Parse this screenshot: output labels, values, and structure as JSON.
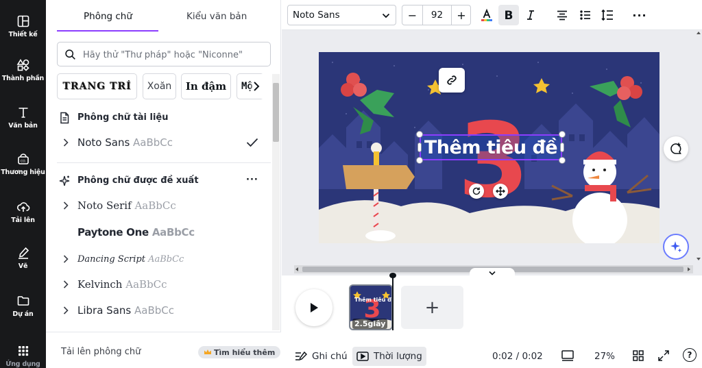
{
  "sidebar": {
    "items": [
      {
        "label": "Thiết kế",
        "icon": "layout-icon"
      },
      {
        "label": "Thành phần",
        "icon": "shapes-icon"
      },
      {
        "label": "Văn bản",
        "icon": "text-icon"
      },
      {
        "label": "Thương hiệu",
        "icon": "brand-icon"
      },
      {
        "label": "Tải lên",
        "icon": "upload-icon"
      },
      {
        "label": "Vẽ",
        "icon": "draw-icon"
      },
      {
        "label": "Dự án",
        "icon": "folder-icon"
      },
      {
        "label": "Ứng dụng",
        "icon": "apps-icon"
      }
    ]
  },
  "panel": {
    "tabs": [
      {
        "label": "Phông chữ",
        "active": true
      },
      {
        "label": "Kiểu văn bản",
        "active": false
      }
    ],
    "search": {
      "placeholder": "Hãy thử \"Thư pháp\" hoặc \"Niconne\""
    },
    "style_chips": [
      "TRANG TRÍ",
      "Xoăn",
      "In đậm",
      "Mộ"
    ],
    "document_fonts": {
      "title": "Phông chữ tài liệu",
      "items": [
        {
          "name": "Noto Sans",
          "sample": "AaBbCc",
          "selected": true
        }
      ]
    },
    "suggested_fonts": {
      "title": "Phông chữ được đề xuất",
      "more": "···",
      "items": [
        {
          "name": "Noto Serif",
          "sample": "AaBbCc"
        },
        {
          "name": "Paytone One",
          "sample": "AaBbCc"
        },
        {
          "name": "Dancing Script",
          "sample": "AaBbCc"
        },
        {
          "name": "Kelvinch",
          "sample": "AaBbCc"
        },
        {
          "name": "Libra Sans",
          "sample": "AaBbCc"
        }
      ]
    },
    "footer": {
      "upload_label": "Tải lên phông chữ",
      "learn_more": "Tìm hiểu thêm"
    }
  },
  "toolbar": {
    "font_family": "Noto Sans",
    "font_size": "92",
    "minus": "−",
    "plus": "+",
    "text_color": "#e8484e",
    "more": "···"
  },
  "canvas": {
    "title_text": "Thêm tiêu đề",
    "big_number": "3",
    "colors": {
      "sky": "#2b3678",
      "snow": "#eeebe4",
      "accent": "#8b3dff"
    }
  },
  "timeline": {
    "page_title": "Thêm tiêu đề",
    "page_duration": "2.5giây",
    "add_page": "+"
  },
  "bottombar": {
    "notes": "Ghi chú",
    "duration": "Thời lượng",
    "time": "0:02 / 0:02",
    "zoom": "27%",
    "help": "?"
  }
}
